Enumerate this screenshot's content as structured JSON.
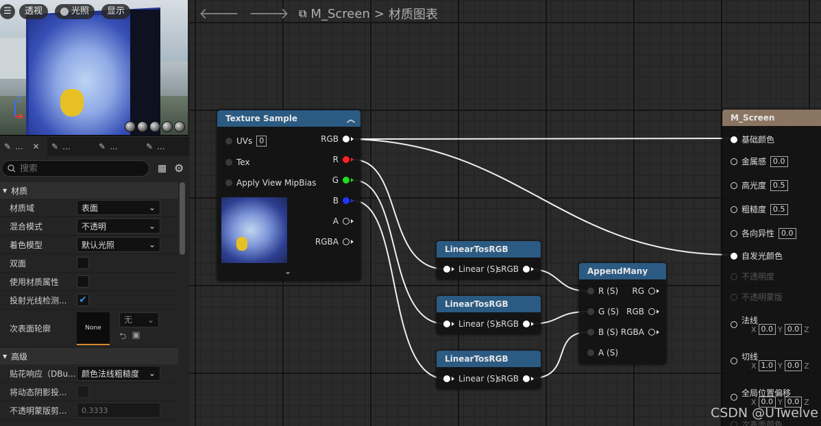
{
  "viewport": {
    "buttons": [
      {
        "label": "透视",
        "icon": "menu-icon"
      },
      {
        "label": "光照",
        "icon": "lighting-icon"
      },
      {
        "label": "显示",
        "icon": ""
      }
    ],
    "axis_z": "Z",
    "axis_x": "X"
  },
  "tabs": [
    {
      "label": "...",
      "active": true
    },
    {
      "label": "...",
      "active": false
    },
    {
      "label": "...",
      "active": false
    },
    {
      "label": "...",
      "active": false
    }
  ],
  "search": {
    "placeholder": "搜索"
  },
  "details": {
    "cat_material": "材质",
    "rows": [
      {
        "label": "材质域",
        "type": "dropdown",
        "value": "表面"
      },
      {
        "label": "混合模式",
        "type": "dropdown",
        "value": "不透明"
      },
      {
        "label": "着色模型",
        "type": "dropdown",
        "value": "默认光照"
      },
      {
        "label": "双面",
        "type": "check",
        "checked": false
      },
      {
        "label": "使用材质属性",
        "type": "check",
        "checked": false
      },
      {
        "label": "投射光线检测...",
        "type": "check",
        "checked": true
      }
    ],
    "subsurface_label": "次表面轮廓",
    "subsurface_thumb": "None",
    "subsurface_dd": "无",
    "cat_advanced": "高级",
    "adv_rows": [
      {
        "label": "贴花响应（DBu...",
        "type": "dropdown",
        "value": "颜色法线粗糙度"
      },
      {
        "label": "将动态阴影投...",
        "type": "check",
        "checked": false
      },
      {
        "label": "不透明蒙版剪...",
        "type": "number",
        "value": "0.3333"
      }
    ]
  },
  "graph": {
    "breadcrumb_asset": "M_Screen",
    "breadcrumb_sep": ">",
    "breadcrumb_graph": "材质图表",
    "texture_node": {
      "title": "Texture Sample",
      "inputs": [
        {
          "label": "UVs",
          "value": "0"
        },
        {
          "label": "Tex",
          "value": ""
        },
        {
          "label": "Apply View MipBias",
          "value": ""
        }
      ],
      "outputs": [
        "RGB",
        "R",
        "G",
        "B",
        "A",
        "RGBA"
      ]
    },
    "linear_nodes": [
      {
        "title": "LinearTosRGB",
        "in": "Linear (S)",
        "out": "sRGB"
      },
      {
        "title": "LinearTosRGB",
        "in": "Linear (S)",
        "out": "sRGB"
      },
      {
        "title": "LinearTosRGB",
        "in": "Linear (S)",
        "out": "sRGB"
      }
    ],
    "append_node": {
      "title": "AppendMany",
      "inputs": [
        "R (S)",
        "G (S)",
        "B (S)",
        "A (S)"
      ],
      "outputs": [
        "RG",
        "RGB",
        "RGBA"
      ]
    },
    "result_node": {
      "title": "M_Screen",
      "pins": [
        {
          "label": "基础颜色",
          "value": "",
          "state": "connected"
        },
        {
          "label": "金属感",
          "value": "0.0",
          "state": "normal"
        },
        {
          "label": "高光度",
          "value": "0.5",
          "state": "normal"
        },
        {
          "label": "粗糙度",
          "value": "0.5",
          "state": "normal"
        },
        {
          "label": "各向异性",
          "value": "0.0",
          "state": "normal"
        },
        {
          "label": "自发光颜色",
          "value": "",
          "state": "connected"
        },
        {
          "label": "不透明度",
          "value": "",
          "state": "disabled"
        },
        {
          "label": "不透明蒙版",
          "value": "",
          "state": "disabled"
        },
        {
          "label": "法线",
          "value": "",
          "state": "vector"
        },
        {
          "label": "切线",
          "value": "",
          "state": "vector"
        },
        {
          "label": "全局位置偏移",
          "value": "",
          "state": "vector"
        },
        {
          "label": "次表面颜色",
          "value": "",
          "state": "disabled"
        }
      ],
      "normal_xyz": [
        "X",
        "0.0",
        "Y",
        "0.0",
        "Z"
      ],
      "tangent_xyz": [
        "X",
        "1.0",
        "Y",
        "0.0",
        "Z"
      ],
      "wpo_xyz": [
        "X",
        "0.0",
        "Y",
        "0.0",
        "Z"
      ]
    }
  },
  "watermark": "CSDN @UTwelve",
  "colors": {
    "node_header": "#2b5a82",
    "result_header": "#8a7462",
    "pin_red": "#ff2222",
    "pin_green": "#22dd22",
    "pin_blue": "#2233ff"
  }
}
